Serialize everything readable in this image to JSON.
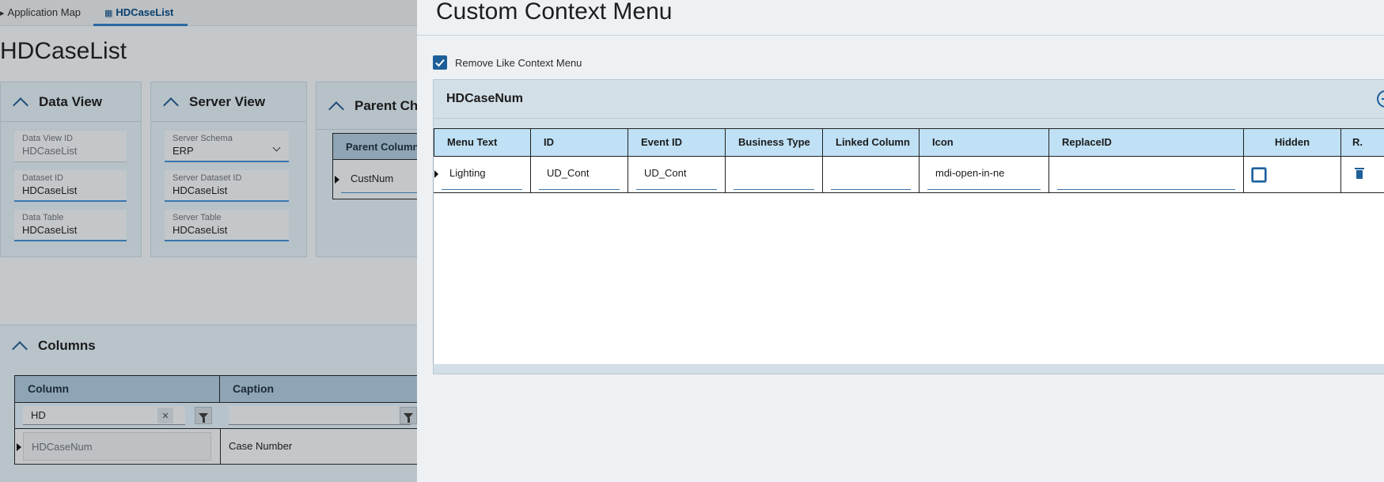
{
  "background": {
    "tabs": [
      {
        "label": "Application Map",
        "icon": "caret-icon"
      },
      {
        "label": "HDCaseList",
        "icon": "grid-icon",
        "active": true
      }
    ],
    "page_title": "HDCaseList",
    "data_view": {
      "title": "Data View",
      "fields": [
        {
          "label": "Data View ID",
          "value": "HDCaseList",
          "readonly": true
        },
        {
          "label": "Dataset ID",
          "value": "HDCaseList"
        },
        {
          "label": "Data Table",
          "value": "HDCaseList"
        }
      ]
    },
    "server_view": {
      "title": "Server View",
      "fields": [
        {
          "label": "Server Schema",
          "value": "ERP",
          "dropdown": true
        },
        {
          "label": "Server Dataset ID",
          "value": "HDCaseList"
        },
        {
          "label": "Server Table",
          "value": "HDCaseList"
        }
      ]
    },
    "parent_child": {
      "title": "Parent Ch",
      "column_header": "Parent Column",
      "row_value": "CustNum"
    },
    "columns": {
      "title": "Columns",
      "headers": [
        "Column",
        "Caption"
      ],
      "filter_value": "HD",
      "row": {
        "column": "HDCaseNum",
        "caption": "Case Number"
      }
    }
  },
  "modal": {
    "title": "Custom Context Menu",
    "checkbox_label": "Remove Like Context Menu",
    "checkbox_checked": true,
    "group_title": "HDCaseNum",
    "grid": {
      "headers": [
        "Menu Text",
        "ID",
        "Event ID",
        "Business Type",
        "Linked Column",
        "Icon",
        "ReplaceID",
        "Hidden",
        "R."
      ],
      "row": {
        "menu_text": "Lighting",
        "id": "UD_Cont",
        "event_id": "UD_Cont",
        "business_type": "",
        "linked_column": "",
        "icon": "mdi-open-in-ne",
        "replace_id": "",
        "hidden": false
      }
    }
  },
  "colors": {
    "accent": "#1e5f99",
    "grid_header": "#bfe0f5",
    "modal_bg": "#eef1f4",
    "group_bg": "#d3dfe6"
  }
}
